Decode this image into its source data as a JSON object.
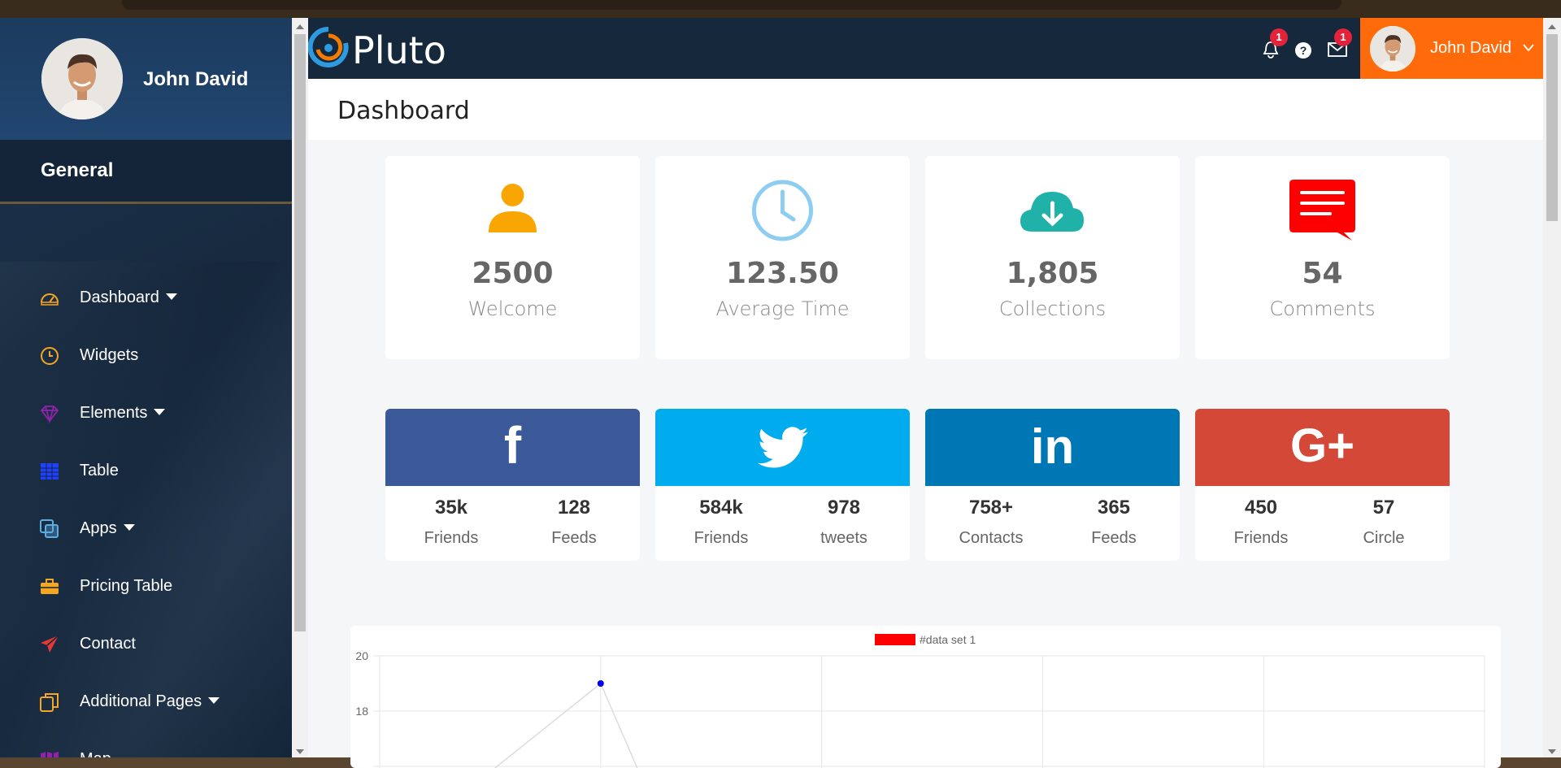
{
  "sidebar": {
    "user_name": "John David",
    "section": "General",
    "items": [
      {
        "label": "Dashboard",
        "icon": "dashboard-icon",
        "dropdown": true,
        "color": "#f5a623"
      },
      {
        "label": "Widgets",
        "icon": "clock-icon",
        "dropdown": false,
        "color": "#f5a623"
      },
      {
        "label": "Elements",
        "icon": "diamond-icon",
        "dropdown": true,
        "color": "#8e24aa"
      },
      {
        "label": "Table",
        "icon": "table-icon",
        "dropdown": false,
        "color": "#1e40ff"
      },
      {
        "label": "Apps",
        "icon": "apps-icon",
        "dropdown": true,
        "color": "#5dade2"
      },
      {
        "label": "Pricing Table",
        "icon": "briefcase-icon",
        "dropdown": false,
        "color": "#f5a623"
      },
      {
        "label": "Contact",
        "icon": "paper-plane-icon",
        "dropdown": false,
        "color": "#e53935"
      },
      {
        "label": "Additional Pages",
        "icon": "pages-icon",
        "dropdown": true,
        "color": "#f5a623"
      },
      {
        "label": "Map",
        "icon": "map-icon",
        "dropdown": false,
        "color": "#8e24aa"
      }
    ]
  },
  "topbar": {
    "brand": "Pluto",
    "notifications_count": "1",
    "messages_count": "1",
    "user_name": "John David",
    "user_bg": "#ff6b0b"
  },
  "page": {
    "title": "Dashboard"
  },
  "stats": [
    {
      "value": "2500",
      "label": "Welcome",
      "icon": "user-icon",
      "color": "#f9a602"
    },
    {
      "value": "123.50",
      "label": "Average Time",
      "icon": "clock-icon",
      "color": "#8dcdf2"
    },
    {
      "value": "1,805",
      "label": "Collections",
      "icon": "cloud-download-icon",
      "color": "#20b2a8"
    },
    {
      "value": "54",
      "label": "Comments",
      "icon": "comment-icon",
      "color": "#ff0000"
    }
  ],
  "social": [
    {
      "network": "facebook",
      "glyph": "f",
      "color": "#3b5998",
      "a_num": "35k",
      "a_cap": "Friends",
      "b_num": "128",
      "b_cap": "Feeds"
    },
    {
      "network": "twitter",
      "glyph": "",
      "color": "#00aced",
      "a_num": "584k",
      "a_cap": "Friends",
      "b_num": "978",
      "b_cap": "tweets"
    },
    {
      "network": "linkedin",
      "glyph": "in",
      "color": "#0077b5",
      "a_num": "758+",
      "a_cap": "Contacts",
      "b_num": "365",
      "b_cap": "Feeds"
    },
    {
      "network": "google-plus",
      "glyph": "G+",
      "color": "#d34836",
      "a_num": "450",
      "a_cap": "Friends",
      "b_num": "57",
      "b_cap": "Circle"
    }
  ],
  "chart_data": {
    "type": "line",
    "series": [
      {
        "name": "#data set 1",
        "color": "#ff0000",
        "points": [
          {
            "x": 1,
            "y": 19
          }
        ]
      }
    ],
    "yticks": [
      "20",
      "18"
    ],
    "ylim": [
      16,
      20
    ],
    "grid": true
  }
}
